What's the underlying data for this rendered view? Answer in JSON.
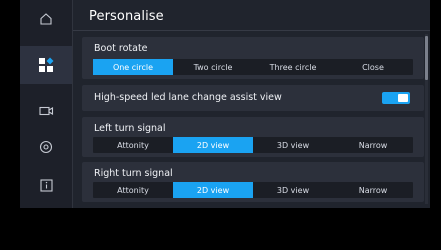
{
  "header": {
    "title": "Personalise"
  },
  "sidebar": {
    "items": [
      {
        "icon": "home-icon",
        "active": false
      },
      {
        "icon": "personalise-icon",
        "active": true
      },
      {
        "icon": "camera-icon",
        "active": false
      },
      {
        "icon": "view-icon",
        "active": false
      },
      {
        "icon": "info-icon",
        "active": false
      }
    ]
  },
  "settings": {
    "boot_rotate": {
      "label": "Boot rotate",
      "options": [
        "One circle",
        "Two circle",
        "Three circle",
        "Close"
      ],
      "selected": "One circle"
    },
    "lane_change": {
      "label": "High-speed led lane change assist view",
      "enabled": true
    },
    "left_turn": {
      "label": "Left turn signal",
      "options": [
        "Attonity",
        "2D view",
        "3D view",
        "Narrow"
      ],
      "selected": "2D view"
    },
    "right_turn": {
      "label": "Right turn signal",
      "options": [
        "Attonity",
        "2D view",
        "3D view",
        "Narrow"
      ],
      "selected": "2D view"
    }
  },
  "colors": {
    "accent": "#1aa3f2",
    "panel": "#2c303b",
    "background": "#20242d"
  }
}
